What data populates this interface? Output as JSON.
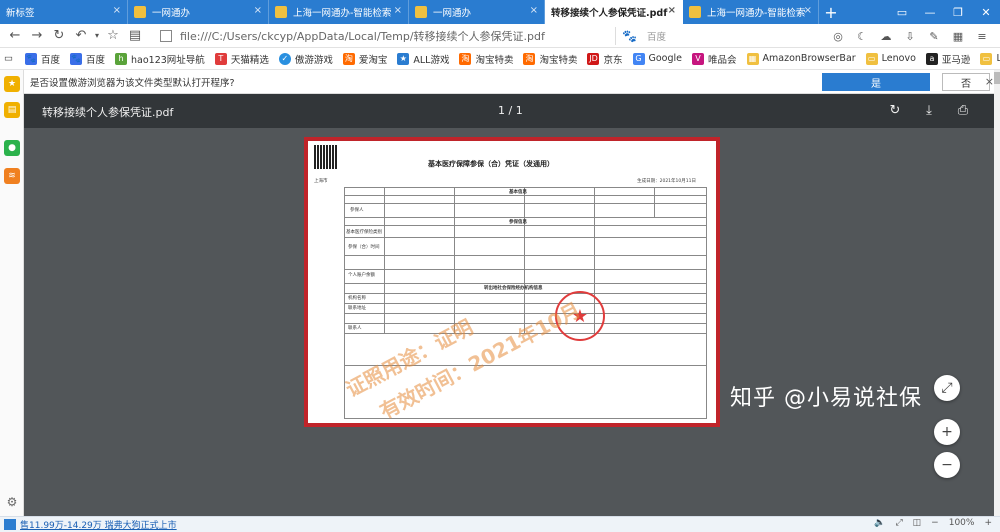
{
  "tabs": [
    {
      "label": "新标签",
      "active": false
    },
    {
      "label": "一网通办",
      "active": false
    },
    {
      "label": "上海一网通办-智能检索",
      "active": false
    },
    {
      "label": "一网通办",
      "active": false
    },
    {
      "label": "转移接续个人参保凭证.pdf",
      "active": true
    },
    {
      "label": "上海一网通办-智能检索",
      "active": false
    }
  ],
  "address_bar": {
    "url": "file:///C:/Users/ckcyp/AppData/Local/Temp/转移接续个人参保凭证.pdf"
  },
  "search": {
    "engine": "百度"
  },
  "bookmarks": [
    "百度",
    "百度",
    "hao123网址导航",
    "天猫精选",
    "傲游游戏",
    "爱淘宝",
    "ALL游戏",
    "淘宝特卖",
    "淘宝特卖",
    "京东",
    "Google",
    "唯品会",
    "AmazonBrowserBar",
    "Lenovo",
    "亚马逊",
    "Li"
  ],
  "infobar": {
    "message": "是否设置傲游浏览器为该文件类型默认打开程序?",
    "yes_label": "是",
    "no_label": "否"
  },
  "viewer": {
    "title": "转移接续个人参保凭证.pdf",
    "page_indicator": "1 / 1"
  },
  "document": {
    "title": "基本医疗保障参保（合）凭证（发通用）",
    "region": "上海市",
    "date": "生成日期：2021年10月11日",
    "section1": "基本信息",
    "section2": "参保信息",
    "section3": "转出地社会保险经办机构信息",
    "row_labels": [
      "参保人",
      "基本医疗保险类别",
      "参保（合）时间",
      "个人账户余额",
      "机构名称",
      "联系地址",
      "联系人"
    ],
    "stamp_text": "★",
    "watermark_line1": "证照用途：证明",
    "watermark_line2": "有效时间：2021年10月"
  },
  "zoom_controls": {
    "fit": "⤢",
    "zoom_in": "+",
    "zoom_out": "−"
  },
  "watermark_brand": "知乎 @小易说社保",
  "status_bar": {
    "news": "售11.99万-14.29万 瑞弗大狗正式上市",
    "zoom": "100%"
  }
}
